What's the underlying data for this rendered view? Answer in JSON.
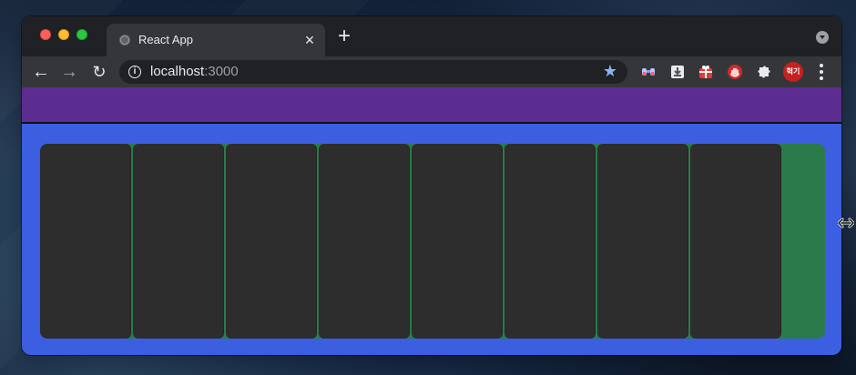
{
  "desktop": {
    "background_color": "#132238"
  },
  "browser": {
    "window_buttons": [
      "close",
      "minimize",
      "maximize"
    ],
    "tabs": [
      {
        "title": "React App",
        "favicon": "globe-icon",
        "close_icon": "close-icon"
      }
    ],
    "new_tab_icon": "plus-icon",
    "tab_search_icon": "chevron-down-icon",
    "toolbar": {
      "back_icon": "arrow-left-icon",
      "forward_icon": "arrow-right-icon",
      "reload_icon": "reload-icon",
      "site_info_icon": "info-icon",
      "bookmark_icon": "star-icon",
      "extensions": [
        "binoculars-icon",
        "download-icon",
        "gift-icon",
        "hand-icon",
        "puzzle-icon"
      ],
      "profile_avatar_text": "헉기",
      "menu_icon": "kebab-menu-icon"
    },
    "address": {
      "host": "localhost",
      "port": ":3000"
    }
  },
  "page": {
    "header_color": "#5c2d91",
    "page_background": "#3c5ee0",
    "board_background": "#2b7a4b",
    "column_color": "#2d2d2d",
    "column_count": 8
  },
  "cursor": {
    "icon": "resize-horizontal-icon"
  }
}
